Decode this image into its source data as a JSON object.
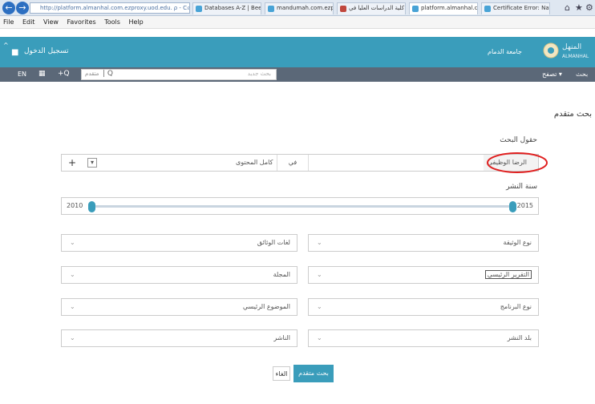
{
  "browser": {
    "address": "http://platform.almanhal.com.ezproxy.uod.edu.sa/Search",
    "address_tail": "ρ - C",
    "tabs": [
      "Databases A-Z | Beera...",
      "mandumah.com.ezp...",
      "كلية الدراسات العليا في ...",
      "platform.almanhal.c...",
      "Certificate Error: Navig..."
    ],
    "menu": [
      "File",
      "Edit",
      "View",
      "Favorites",
      "Tools",
      "Help"
    ]
  },
  "header": {
    "login_label": "تسجيل الدخول",
    "university": "جامعة الدمام",
    "logo_text": "ALMANHAL",
    "logo_arabic": "المنهل"
  },
  "toolbar": {
    "lang": "EN",
    "search_placeholder": "بحث جديد",
    "scope": "متقدم",
    "browse_label": "تصفح ▾",
    "search_label": "بحث"
  },
  "page": {
    "title": "بحث متقدم",
    "fields_label": "حقول البحث",
    "field_value": "الرضا الوظيفي",
    "in_label": "في",
    "scope_value": "كامل المحتوى",
    "year_label": "سنة النشر",
    "year_from": "2010",
    "year_to": "2015",
    "year_range": {
      "min": 2010,
      "max": 2015
    },
    "filters": {
      "doc_type": "نوع الوثيقة",
      "doc_lang": "لغات الوثائق",
      "main_report": "التقرير الرئيسي",
      "journal": "المجلة",
      "program_type": "نوع البرنامج",
      "main_subject": "الموضوع الرئيسي",
      "country": "بلد النشر",
      "publisher": "الناشر"
    },
    "cancel_label": "الغاء",
    "submit_label": "بحث متقدم"
  },
  "colors": {
    "accent": "#3a9dbb",
    "toolbar": "#5b6878",
    "highlight": "#e02020"
  }
}
